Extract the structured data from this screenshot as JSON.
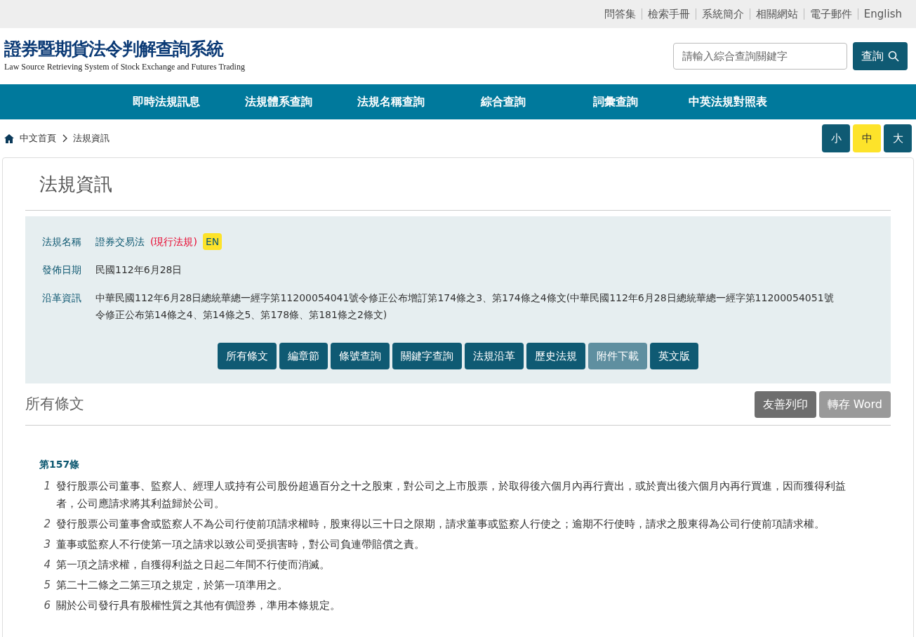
{
  "top_links": [
    "問答集",
    "檢索手冊",
    "系統簡介",
    "相關網站",
    "電子郵件",
    "English"
  ],
  "logo": {
    "title": "證券暨期貨法令判解查詢系統",
    "subtitle": "Law Source Retrieving System of Stock Exchange and Futures Trading"
  },
  "search": {
    "placeholder": "請輸入綜合查詢關鍵字",
    "button": "查詢"
  },
  "nav": [
    "即時法規訊息",
    "法規體系查詢",
    "法規名稱查詢",
    "綜合查詢",
    "詞彙查詢",
    "中英法規對照表"
  ],
  "breadcrumb": [
    "中文首頁",
    "法規資訊"
  ],
  "font_sizes": [
    {
      "label": "小",
      "selected": false
    },
    {
      "label": "中",
      "selected": true
    },
    {
      "label": "大",
      "selected": false
    }
  ],
  "page_title": "法規資訊",
  "info": [
    {
      "kind": "name",
      "label": "法規名稱",
      "value": "證券交易法",
      "status": "(現行法規)",
      "badge": "EN"
    },
    {
      "kind": "text",
      "label": "發佈日期",
      "value": "民國112年6月28日"
    },
    {
      "kind": "text",
      "label": "沿革資訊",
      "value": "中華民國112年6月28日總統華總一經字第11200054041號令修正公布增訂第174條之3、第174條之4條文(中華民國112年6月28日總統華總一經字第11200054051號令修正公布第14條之4、第14條之5、第178條、第181條之2條文)"
    }
  ],
  "actions": [
    {
      "label": "所有條文",
      "disabled": false
    },
    {
      "label": "編章節",
      "disabled": false
    },
    {
      "label": "條號查詢",
      "disabled": false
    },
    {
      "label": "關鍵字查詢",
      "disabled": false
    },
    {
      "label": "法規沿革",
      "disabled": false
    },
    {
      "label": "歷史法規",
      "disabled": false
    },
    {
      "label": "附件下載",
      "disabled": true
    },
    {
      "label": "英文版",
      "disabled": false
    }
  ],
  "section": {
    "title": "所有條文",
    "buttons": [
      {
        "label": "友善列印",
        "kind": "dark"
      },
      {
        "label": "轉存 Word",
        "kind": "light"
      }
    ]
  },
  "article": {
    "title": "第157條",
    "paragraphs": [
      {
        "number": "1",
        "text": "發行股票公司董事、監察人、經理人或持有公司股份超過百分之十之股東，對公司之上市股票，於取得後六個月內再行賣出，或於賣出後六個月內再行買進，因而獲得利益者，公司應請求將其利益歸於公司。"
      },
      {
        "number": "2",
        "text": "發行股票公司董事會或監察人不為公司行使前項請求權時，股東得以三十日之限期，請求董事或監察人行使之；逾期不行使時，請求之股東得為公司行使前項請求權。"
      },
      {
        "number": "3",
        "text": "董事或監察人不行使第一項之請求以致公司受損害時，對公司負連帶賠償之責。"
      },
      {
        "number": "4",
        "text": "第一項之請求權，自獲得利益之日起二年間不行使而消滅。"
      },
      {
        "number": "5",
        "text": "第二十二條之二第三項之規定，於第一項準用之。"
      },
      {
        "number": "6",
        "text": "關於公司發行具有股權性質之其他有價證券，準用本條規定。"
      }
    ]
  }
}
